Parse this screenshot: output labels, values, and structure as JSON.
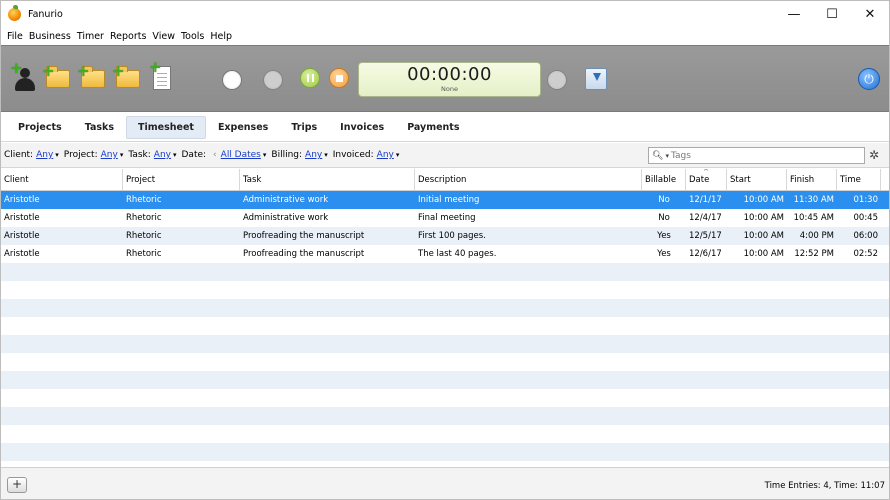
{
  "window": {
    "title": "Fanurio",
    "minimize": "—",
    "maximize": "☐",
    "close": "✕"
  },
  "menu": [
    "File",
    "Business",
    "Timer",
    "Reports",
    "View",
    "Tools",
    "Help"
  ],
  "toolbar": {
    "timer_time": "00:00:00",
    "timer_task": "None",
    "power_icon": "⏻",
    "plus": "+"
  },
  "tabs": [
    "Projects",
    "Tasks",
    "Timesheet",
    "Expenses",
    "Trips",
    "Invoices",
    "Payments"
  ],
  "active_tab": "Timesheet",
  "filters": {
    "client_label": "Client:",
    "client": "Any",
    "project_label": "Project:",
    "project": "Any",
    "task_label": "Task:",
    "task": "Any",
    "date_label": "Date:",
    "date_prev": "‹",
    "date": "All Dates",
    "billing_label": "Billing:",
    "billing": "Any",
    "invoiced_label": "Invoiced:",
    "invoiced": "Any",
    "drop": "▾"
  },
  "search": {
    "icon": "🔍︎",
    "drop": "▾",
    "placeholder": "Tags"
  },
  "gear_icon": "✲",
  "columns": [
    "Client",
    "Project",
    "Task",
    "Description",
    "Billable",
    "Date",
    "Start",
    "Finish",
    "Time"
  ],
  "rows": [
    {
      "client": "Aristotle",
      "project": "Rhetoric",
      "task": "Administrative work",
      "description": "Initial meeting",
      "billable": "No",
      "date": "12/1/17",
      "start": "10:00 AM",
      "finish": "11:30 AM",
      "time": "01:30"
    },
    {
      "client": "Aristotle",
      "project": "Rhetoric",
      "task": "Administrative work",
      "description": "Final meeting",
      "billable": "No",
      "date": "12/4/17",
      "start": "10:00 AM",
      "finish": "10:45 AM",
      "time": "00:45"
    },
    {
      "client": "Aristotle",
      "project": "Rhetoric",
      "task": "Proofreading the manuscript",
      "description": "First 100 pages.",
      "billable": "Yes",
      "date": "12/5/17",
      "start": "10:00 AM",
      "finish": "4:00 PM",
      "time": "06:00"
    },
    {
      "client": "Aristotle",
      "project": "Rhetoric",
      "task": "Proofreading the manuscript",
      "description": "The last 40 pages.",
      "billable": "Yes",
      "date": "12/6/17",
      "start": "10:00 AM",
      "finish": "12:52 PM",
      "time": "02:52"
    }
  ],
  "sort_mark": "^",
  "status": {
    "add": "+",
    "text": "Time Entries: 4, Time: 11:07"
  }
}
